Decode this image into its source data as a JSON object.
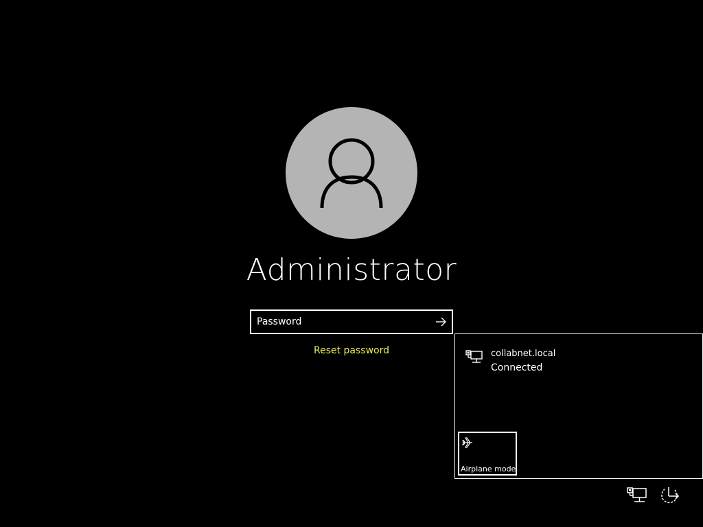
{
  "user": {
    "name": "Administrator"
  },
  "password": {
    "placeholder": "Password",
    "value": ""
  },
  "reset_link": "Reset password",
  "network_flyout": {
    "network_name": "collabnet.local",
    "network_status": "Connected",
    "airplane_mode_label": "Airplane mode"
  },
  "icons": {
    "avatar": "user-silhouette-icon",
    "submit": "arrow-right-icon",
    "network": "wired-network-icon",
    "airplane": "airplane-icon",
    "tray_network": "wired-network-icon",
    "tray_power": "power-restart-icon"
  },
  "colors": {
    "background": "#000000",
    "avatar_circle": "#b4b4b4",
    "link": "#e8e87a",
    "text": "#ffffff"
  }
}
